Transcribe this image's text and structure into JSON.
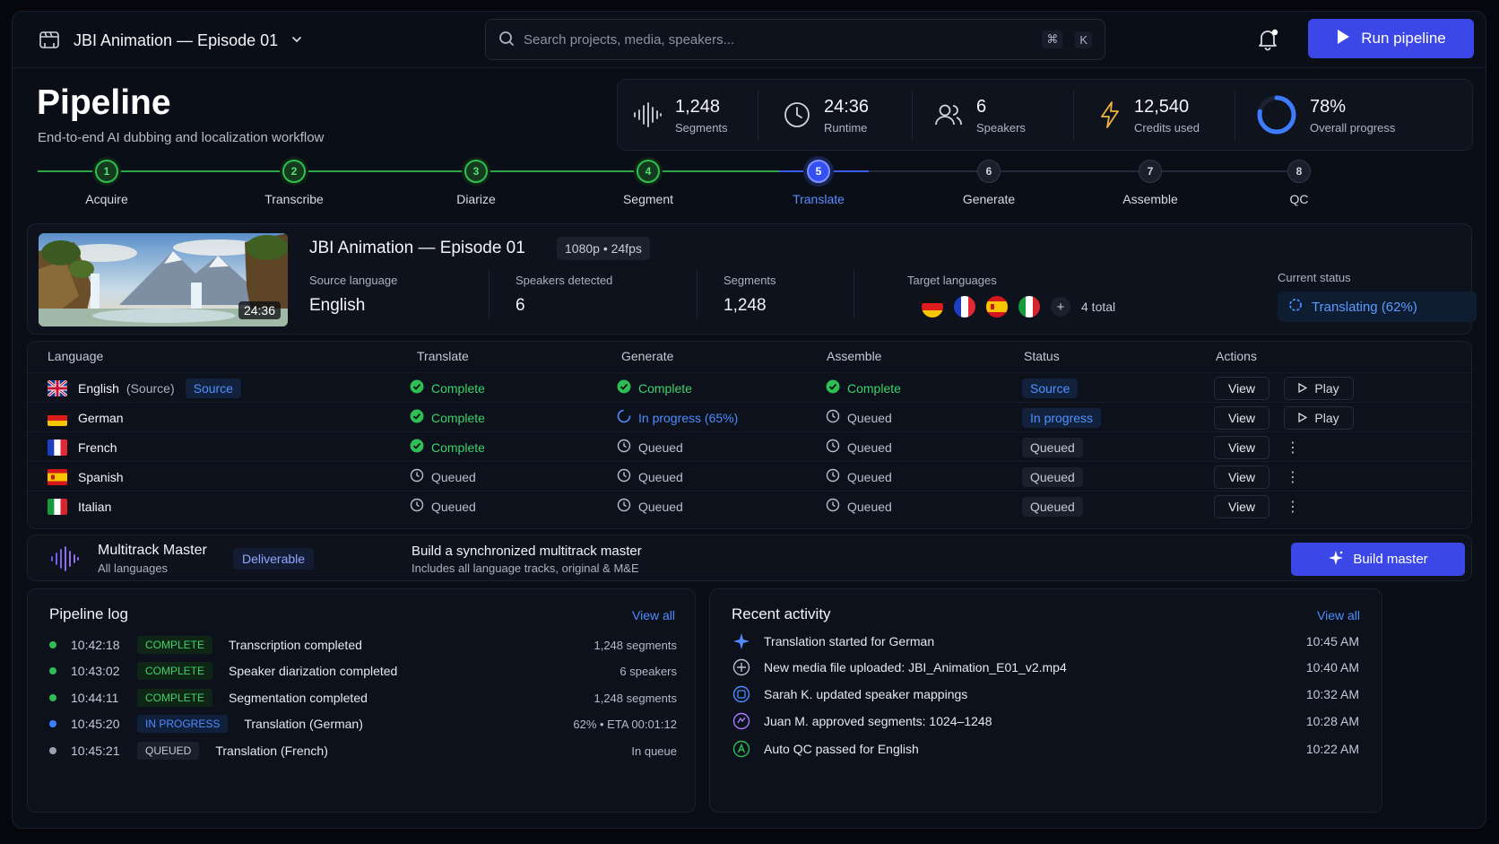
{
  "topbar": {
    "project_title": "JBI Animation — Episode 01",
    "search_placeholder": "Search projects, media, speakers...",
    "shortcut_cmd": "⌘",
    "shortcut_key": "K",
    "run_label": "Run pipeline"
  },
  "header": {
    "title": "Pipeline",
    "subtitle": "End-to-end AI dubbing and localization workflow"
  },
  "stats": [
    {
      "value": "1,248",
      "label": "Segments",
      "icon": "waveform-icon"
    },
    {
      "value": "24:36",
      "label": "Runtime",
      "icon": "clock-icon"
    },
    {
      "value": "6",
      "label": "Speakers",
      "icon": "users-icon"
    },
    {
      "value": "12,540",
      "label": "Credits used",
      "icon": "bolt-icon"
    },
    {
      "value": "78%",
      "label": "Overall progress",
      "icon": "progress-ring-icon",
      "progress": 0.78
    }
  ],
  "steps": [
    {
      "n": "1",
      "label": "Acquire",
      "state": "done"
    },
    {
      "n": "2",
      "label": "Transcribe",
      "state": "done"
    },
    {
      "n": "3",
      "label": "Diarize",
      "state": "done"
    },
    {
      "n": "4",
      "label": "Segment",
      "state": "done"
    },
    {
      "n": "5",
      "label": "Translate",
      "state": "active"
    },
    {
      "n": "6",
      "label": "Generate",
      "state": "todo"
    },
    {
      "n": "7",
      "label": "Assemble",
      "state": "todo"
    },
    {
      "n": "8",
      "label": "QC",
      "state": "todo"
    }
  ],
  "media": {
    "duration": "24:36",
    "title": "JBI Animation — Episode 01",
    "format": "1080p • 24fps",
    "source_language_label": "Source language",
    "source_language": "English",
    "speakers_label": "Speakers detected",
    "speakers": "6",
    "segments_label": "Segments",
    "segments": "1,248",
    "targets_label": "Target languages",
    "targets_total": "4 total",
    "add_symbol": "+",
    "status_label": "Current status",
    "status_value": "Translating (62%)"
  },
  "table": {
    "headers": {
      "language": "Language",
      "translate": "Translate",
      "generate": "Generate",
      "assemble": "Assemble",
      "status": "Status",
      "actions": "Actions"
    },
    "rows": [
      {
        "lang": "English",
        "source_note": "(Source)",
        "source_tag": "Source",
        "flag": "uk",
        "translate": "Complete",
        "t_state": "ok",
        "generate": "Complete",
        "g_state": "ok",
        "assemble": "Complete",
        "a_state": "ok",
        "status": "Source",
        "s_state": "src",
        "view": "View",
        "play": "Play"
      },
      {
        "lang": "German",
        "flag": "de",
        "translate": "Complete",
        "t_state": "ok",
        "generate": "In progress (65%)",
        "g_state": "prog",
        "assemble": "Queued",
        "a_state": "q",
        "status": "In progress",
        "s_state": "src",
        "view": "View",
        "play": "Play"
      },
      {
        "lang": "French",
        "flag": "fr",
        "translate": "Complete",
        "t_state": "ok",
        "generate": "Queued",
        "g_state": "q",
        "assemble": "Queued",
        "a_state": "q",
        "status": "Queued",
        "s_state": "q",
        "view": "View",
        "more": "⋮"
      },
      {
        "lang": "Spanish",
        "flag": "es",
        "translate": "Queued",
        "t_state": "q",
        "generate": "Queued",
        "g_state": "q",
        "assemble": "Queued",
        "a_state": "q",
        "status": "Queued",
        "s_state": "q",
        "view": "View",
        "more": "⋮"
      },
      {
        "lang": "Italian",
        "flag": "it",
        "translate": "Queued",
        "t_state": "q",
        "generate": "Queued",
        "g_state": "q",
        "assemble": "Queued",
        "a_state": "q",
        "status": "Queued",
        "s_state": "q",
        "view": "View",
        "more": "⋮"
      }
    ]
  },
  "master": {
    "title": "Multitrack Master",
    "subtitle": "All languages",
    "tag": "Deliverable",
    "headline": "Build a synchronized multitrack master",
    "detail": "Includes all language tracks, original & M&E",
    "button": "Build master"
  },
  "log": {
    "title": "Pipeline log",
    "view_all": "View all",
    "rows": [
      {
        "time": "10:42:18",
        "badge": "COMPLETE",
        "state": "ok",
        "msg": "Transcription completed",
        "meta": "1,248 segments"
      },
      {
        "time": "10:43:02",
        "badge": "COMPLETE",
        "state": "ok",
        "msg": "Speaker diarization completed",
        "meta": "6 speakers"
      },
      {
        "time": "10:44:11",
        "badge": "COMPLETE",
        "state": "ok",
        "msg": "Segmentation completed",
        "meta": "1,248 segments"
      },
      {
        "time": "10:45:20",
        "badge": "IN PROGRESS",
        "state": "prog",
        "msg": "Translation (German)",
        "meta": "62% • ETA 00:01:12"
      },
      {
        "time": "10:45:21",
        "badge": "QUEUED",
        "state": "q",
        "msg": "Translation (French)",
        "meta": "In queue"
      }
    ]
  },
  "activity": {
    "title": "Recent activity",
    "view_all": "View all",
    "rows": [
      {
        "icon": "sparkle-icon",
        "msg": "Translation started for German",
        "time": "10:45 AM"
      },
      {
        "icon": "upload-icon",
        "msg": "New media file uploaded: JBI_Animation_E01_v2.mp4",
        "time": "10:40 AM"
      },
      {
        "icon": "speaker-map-icon",
        "msg": "Sarah K. updated speaker mappings",
        "time": "10:32 AM"
      },
      {
        "icon": "approve-icon",
        "msg": "Juan M. approved segments: 1024–1248",
        "time": "10:28 AM"
      },
      {
        "icon": "qc-pass-icon",
        "msg": "Auto QC passed for English",
        "time": "10:22 AM"
      }
    ]
  },
  "colors": {
    "accent": "#3b47e6",
    "success": "#3ed36a",
    "progress": "#4d8dff",
    "background": "#0a0e17"
  }
}
